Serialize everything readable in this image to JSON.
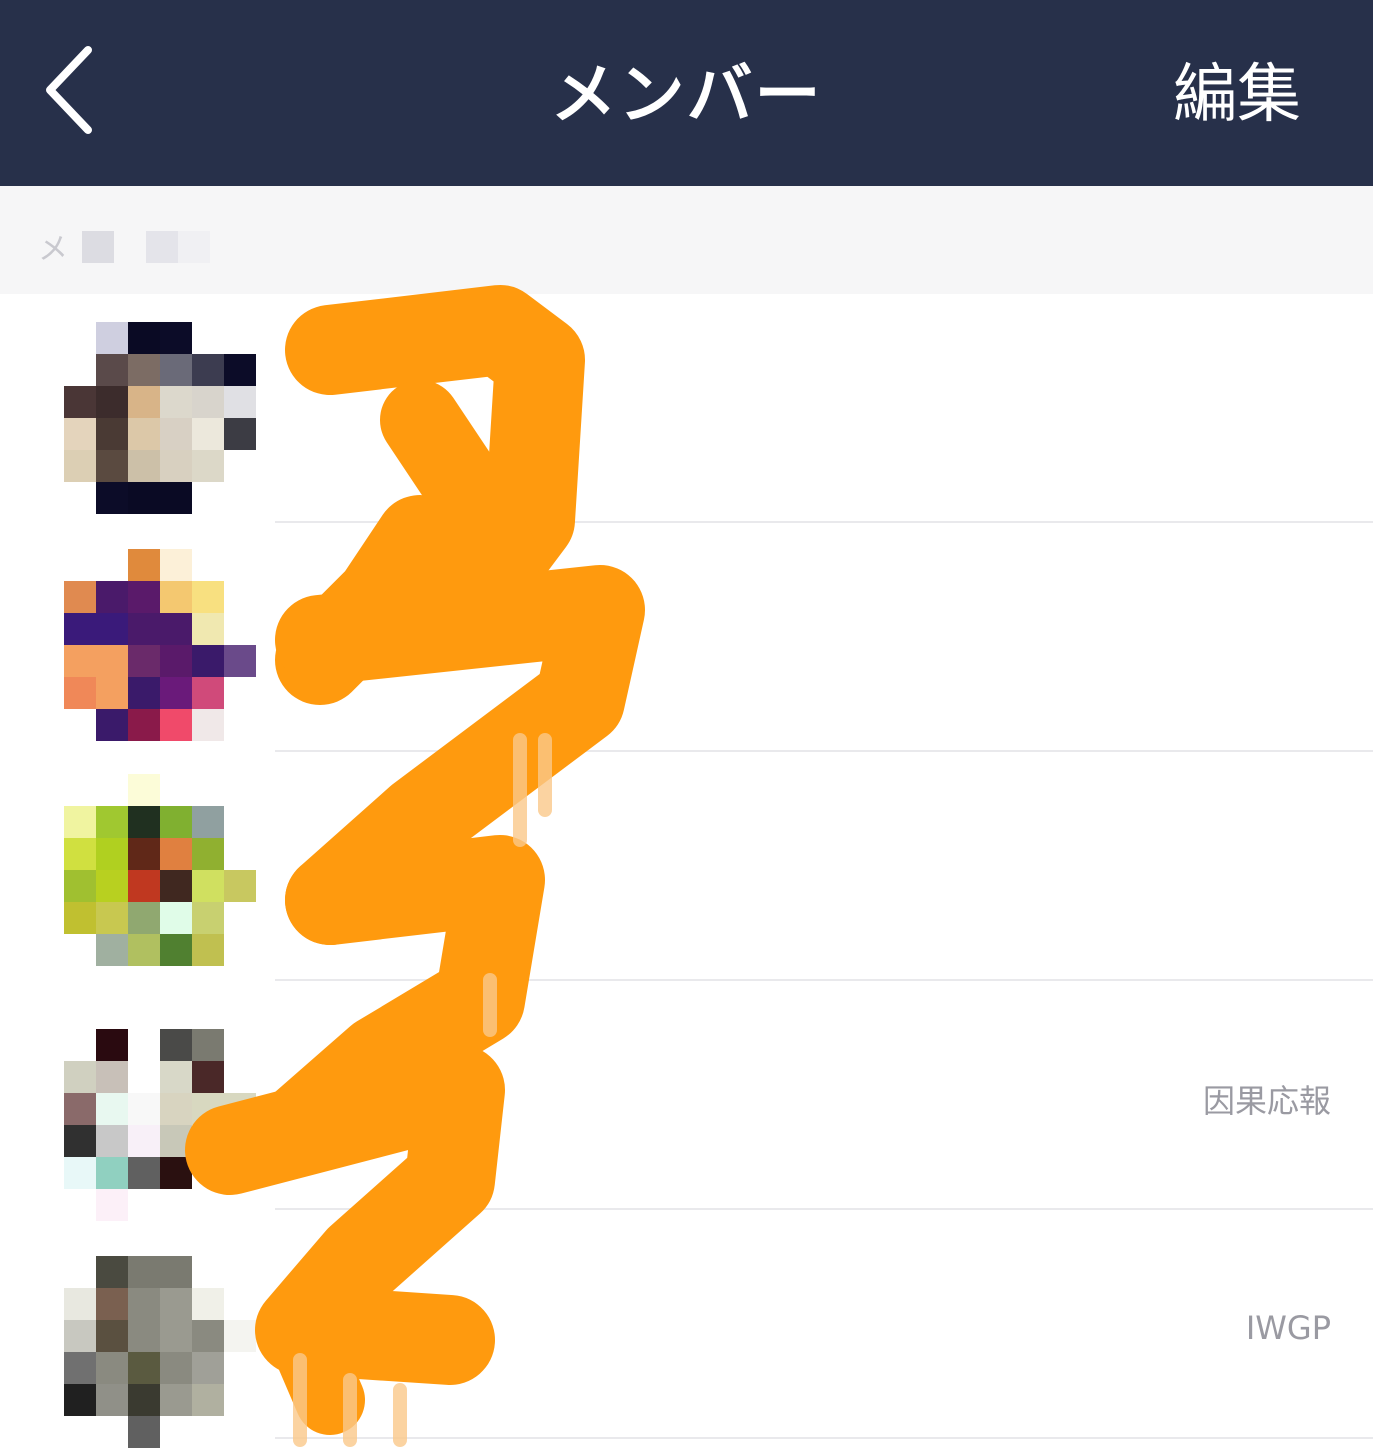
{
  "header": {
    "back_icon": "chevron-left-icon",
    "title": "メンバー",
    "edit_label": "編集"
  },
  "section": {
    "label": "メ"
  },
  "members": [
    {
      "status": "",
      "avatar": [
        "#ffffff",
        "#cfcfe0",
        "#0a0a24",
        "#0c0c28",
        "#ffffff",
        "#ffffff",
        "#ffffff",
        "#5a4a4a",
        "#7c6c64",
        "#6a6a78",
        "#3c3c50",
        "#0c0c28",
        "#4a3636",
        "#3c2c2c",
        "#d8b488",
        "#dcd8cc",
        "#d8d4cc",
        "#e0e0e4",
        "#e4d4bc",
        "#4a3a34",
        "#dcc8a8",
        "#d8d0c4",
        "#ece8dc",
        "#3c3c44",
        "#dccfb4",
        "#5a4a40",
        "#ccc0a8",
        "#d8d0c0",
        "#dcd8c8",
        "#ffffff",
        "#ffffff",
        "#0c0c28",
        "#0a0a24",
        "#0a0a24",
        "#ffffff",
        "#ffffff"
      ]
    },
    {
      "status": "",
      "avatar": [
        "#ffffff",
        "#ffffff",
        "#e08a3c",
        "#fcf0d8",
        "#ffffff",
        "#ffffff",
        "#e08a50",
        "#4a1a6a",
        "#5a1a6a",
        "#f4c870",
        "#f8e080",
        "#ffffff",
        "#3a1a7a",
        "#3a1a7a",
        "#4a1a6a",
        "#4a1a6a",
        "#f0e8b0",
        "#ffffff",
        "#f4a060",
        "#f4a060",
        "#6a2a6a",
        "#5a1a6a",
        "#3a1a6a",
        "#6a4a8a",
        "#f08858",
        "#f4a060",
        "#3a1a6a",
        "#6a1a7a",
        "#d04a7a",
        "#ffffff",
        "#ffffff",
        "#3a1a6a",
        "#8a1a4a",
        "#f04a6a",
        "#f0e8e8",
        "#ffffff"
      ]
    },
    {
      "status": "",
      "avatar": [
        "#ffffff",
        "#ffffff",
        "#fcfcd8",
        "#ffffff",
        "#ffffff",
        "#ffffff",
        "#f0f4a0",
        "#a0c830",
        "#203020",
        "#80b030",
        "#90a0a0",
        "#ffffff",
        "#d0e040",
        "#b0d020",
        "#602818",
        "#e08040",
        "#90b030",
        "#ffffff",
        "#a0c030",
        "#b8d020",
        "#c03820",
        "#402820",
        "#d0e060",
        "#c8c860",
        "#c0c030",
        "#c8c850",
        "#90a870",
        "#e0fce8",
        "#c8d070",
        "#ffffff",
        "#ffffff",
        "#a0b0a0",
        "#b0c060",
        "#508030",
        "#c0c050",
        "#ffffff"
      ]
    },
    {
      "status": "因果応報",
      "avatar": [
        "#ffffff",
        "#2a0a10",
        "#ffffff",
        "#4a4a48",
        "#7a7a70",
        "#ffffff",
        "#d0d0c0",
        "#c8c0b8",
        "#ffffff",
        "#d8d8c8",
        "#4a2828",
        "#ffffff",
        "#8a6a6a",
        "#e8f8f0",
        "#f8f8f8",
        "#d8d4c0",
        "#d8d8c0",
        "#d8d8c0",
        "#303030",
        "#c8c8c8",
        "#f8f0f8",
        "#c8c8b8",
        "#f0f0e0",
        "#ffffff",
        "#e8f8f8",
        "#90d0c0",
        "#606060",
        "#2a1010",
        "#ffffff",
        "#ffffff",
        "#ffffff",
        "#fcf0f8",
        "#ffffff",
        "#ffffff",
        "#ffffff",
        "#ffffff"
      ]
    },
    {
      "status": "IWGP",
      "avatar": [
        "#ffffff",
        "#4a4a40",
        "#7a7a70",
        "#7a7a70",
        "#ffffff",
        "#ffffff",
        "#e8e8e0",
        "#7a6050",
        "#8a8a80",
        "#9a9a90",
        "#f0f0e8",
        "#ffffff",
        "#c8c8c0",
        "#5a5040",
        "#8a8a80",
        "#9a9a90",
        "#8a8a80",
        "#f4f4f0",
        "#707070",
        "#8a8a80",
        "#5a5a40",
        "#8a8a80",
        "#a0a098",
        "#ffffff",
        "#202020",
        "#909088",
        "#3a3a30",
        "#9a9a90",
        "#b0b0a0",
        "#ffffff",
        "#ffffff",
        "#ffffff",
        "#606060",
        "#ffffff",
        "#ffffff",
        "#ffffff"
      ]
    }
  ]
}
